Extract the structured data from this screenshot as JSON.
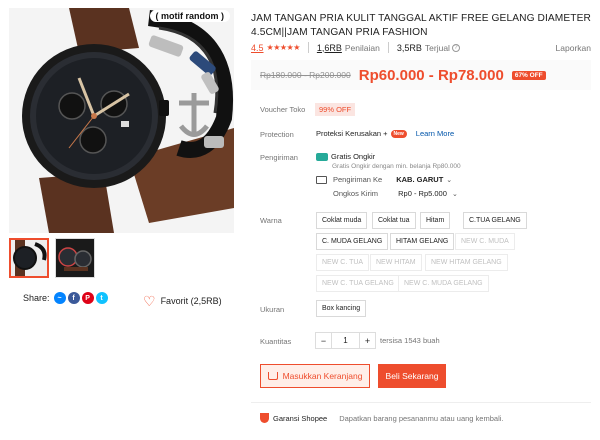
{
  "gallery": {
    "motif_tag": "( motif random )"
  },
  "share": {
    "label": "Share:"
  },
  "favorite": {
    "label": "Favorit (2,5RB)"
  },
  "product": {
    "title": "JAM TANGAN PRIA KULIT TANGGAL AKTIF FREE GELANG DIAMETER 4.5CM||JAM TANGAN PRIA FASHION",
    "rating_score": "4.5",
    "stars": "★★★★★",
    "rating_count": "1,6RB",
    "rating_label": "Penilaian",
    "sold_count": "3,5RB",
    "sold_label": "Terjual",
    "report_label": "Laporkan",
    "old_price": "Rp180.000 - Rp200.000",
    "new_price": "Rp60.000 - Rp78.000",
    "discount_badge": "67% OFF"
  },
  "voucher": {
    "label": "Voucher Toko",
    "chip": "99% OFF"
  },
  "protection": {
    "label": "Protection",
    "text": "Proteksi Kerusakan +",
    "new_badge": "New",
    "learn_more": "Learn More"
  },
  "shipping": {
    "label": "Pengiriman",
    "free_title": "Gratis Ongkir",
    "free_sub": "Gratis Ongkir dengan min. belanja Rp80.000",
    "to_label": "Pengiriman Ke",
    "destination": "KAB. GARUT",
    "cost_label": "Ongkos Kirim",
    "cost_value": "Rp0 - Rp5.000"
  },
  "color": {
    "label": "Warna",
    "options": [
      "Coklat muda",
      "Coklat tua",
      "Hitam",
      "C.TUA GELANG",
      "C. MUDA GELANG",
      "HITAM GELANG",
      "NEW C. MUDA",
      "NEW C. TUA",
      "NEW HITAM",
      "NEW HITAM GELANG",
      "NEW C. TUA GELANG",
      "NEW C. MUDA GELANG"
    ],
    "disabled": [
      "NEW C. MUDA",
      "NEW C. TUA",
      "NEW HITAM",
      "NEW HITAM GELANG",
      "NEW C. TUA GELANG",
      "NEW C. MUDA GELANG"
    ]
  },
  "size": {
    "label": "Ukuran",
    "option": "Box kancing"
  },
  "quantity": {
    "label": "Kuantitas",
    "minus": "−",
    "value": "1",
    "plus": "+",
    "stock": "tersisa 1543 buah"
  },
  "actions": {
    "cart": "Masukkan Keranjang",
    "buy": "Beli Sekarang"
  },
  "guarantee": {
    "title": "Garansi Shopee",
    "desc": "Dapatkan barang pesananmu atau uang kembali."
  },
  "colors": {
    "accent": "#ee4d2d",
    "teal": "#26aa99",
    "link": "#0055aa"
  }
}
